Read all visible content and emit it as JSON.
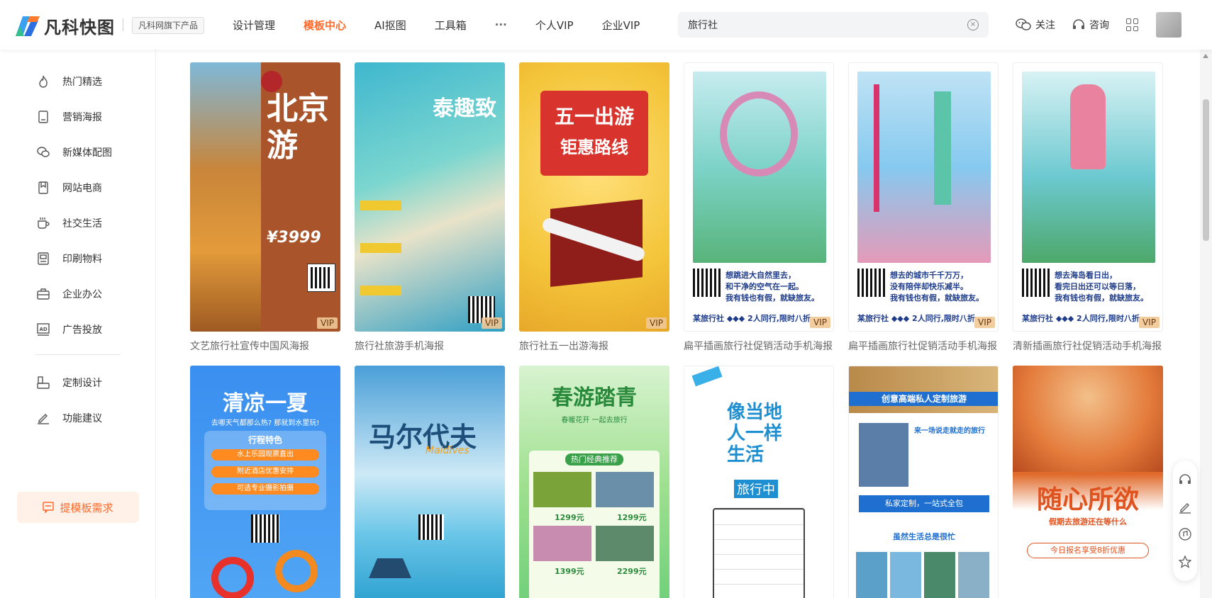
{
  "brand": {
    "name": "凡科快图",
    "tag": "凡科网旗下产品"
  },
  "nav": [
    {
      "label": "设计管理"
    },
    {
      "label": "模板中心",
      "active": true
    },
    {
      "label": "AI抠图"
    },
    {
      "label": "工具箱"
    },
    {
      "label": "···"
    },
    {
      "label": "个人VIP"
    },
    {
      "label": "企业VIP"
    }
  ],
  "search": {
    "value": "旅行社"
  },
  "top_right": {
    "follow": "关注",
    "consult": "咨询"
  },
  "sidebar": {
    "items": [
      {
        "label": "热门精选",
        "icon": "flame-icon"
      },
      {
        "label": "营销海报",
        "icon": "poster-icon"
      },
      {
        "label": "新媒体配图",
        "icon": "chat-icon"
      },
      {
        "label": "网站电商",
        "icon": "bookmark-icon"
      },
      {
        "label": "社交生活",
        "icon": "cup-icon"
      },
      {
        "label": "印刷物料",
        "icon": "print-icon"
      },
      {
        "label": "企业办公",
        "icon": "briefcase-icon"
      },
      {
        "label": "广告投放",
        "icon": "ad-icon"
      }
    ],
    "items2": [
      {
        "label": "定制设计",
        "icon": "custom-icon"
      },
      {
        "label": "功能建议",
        "icon": "edit-icon"
      }
    ],
    "request_button": "提模板需求"
  },
  "templates_row1": [
    {
      "caption": "文艺旅行社宣传中国风海报",
      "vip": "VIP",
      "title": "北京游",
      "price": "¥3999",
      "theme": "#b85a2a"
    },
    {
      "caption": "旅行社旅游手机海报",
      "vip": "VIP",
      "title": "泰趣致",
      "theme": "#3ab0c9"
    },
    {
      "caption": "旅行社五一出游海报",
      "vip": "VIP",
      "title": "五一出游",
      "subtitle": "钜惠路线",
      "theme": "#f4c53a"
    },
    {
      "caption": "扁平插画旅行社促销活动手机海报",
      "vip": "VIP",
      "title": "想跳进大自然里去，",
      "line2": "和干净的空气在一起。",
      "line3": "我有钱也有假，就缺旅友。",
      "footer": "某旅行社  ◆◆◆ 2人同行,限时八折",
      "theme": "#7dd3c8"
    },
    {
      "caption": "扁平插画旅行社促销活动手机海报",
      "vip": "VIP",
      "title": "想去的城市千千万万，",
      "line2": "没有陪伴却快乐减半。",
      "line3": "我有钱也有假，就缺旅友。",
      "footer": "某旅行社  ◆◆◆ 2人同行,限时八折",
      "theme": "#86c9ef"
    },
    {
      "caption": "清新插画旅行社促销活动手机海报",
      "vip": "VIP",
      "title": "想去海岛看日出，",
      "line2": "看完日出还可以等日落，",
      "line3": "我有钱也有假，就缺旅友。",
      "footer": "某旅行社  ◆◆◆ 2人同行,限时八折",
      "theme": "#6cc9d0"
    }
  ],
  "templates_row2": [
    {
      "title": "清凉一夏",
      "sub": "去哪天气都那么热? 那就到水里玩!",
      "tag": "行程特色",
      "items": [
        "水上乐园现票直出",
        "附近酒店优惠安排",
        "可选专业摄影拍摄"
      ],
      "theme": "#3a8ff0"
    },
    {
      "title": "马尔代夫",
      "sub": "Maldives",
      "theme": "#5eb9e8"
    },
    {
      "title": "春游踏青",
      "sub": "春暖花开 一起去旅行",
      "tag": "热门经典推荐",
      "prices": [
        "1299元",
        "1299元",
        "1399元",
        "2299元"
      ],
      "theme": "#6fcf7a"
    },
    {
      "title": "像当地人一样生活",
      "sub": "旅行中",
      "theme": "#2aa0d8"
    },
    {
      "title": "创意高端私人定制旅游",
      "sub": "来一场说走就走的旅行",
      "tag": "私家定制，一站式全包",
      "extra": "虽然生活总是很忙",
      "theme": "#1e6fd0"
    },
    {
      "title": "随心所欲",
      "sub": "假期去旅游还在等什么",
      "tag": "今日报名享受8折优惠",
      "theme": "#e0521e"
    }
  ]
}
